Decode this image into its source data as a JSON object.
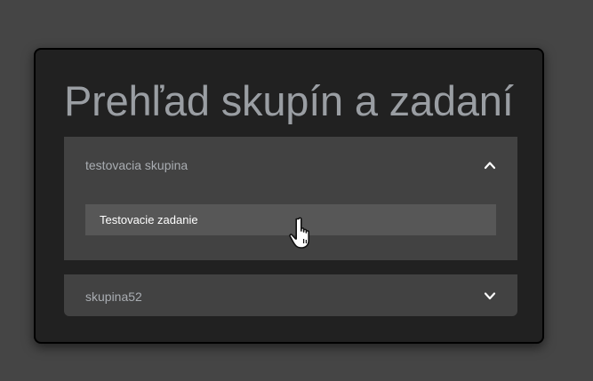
{
  "page": {
    "title": "Prehľad skupín a zadaní"
  },
  "groups": [
    {
      "name": "testovacia skupina",
      "expanded": true,
      "chevron_icon": "chevron-up-icon",
      "tasks": [
        {
          "label": "Testovacie zadanie"
        }
      ]
    },
    {
      "name": "skupina52",
      "expanded": false,
      "chevron_icon": "chevron-down-icon",
      "tasks": []
    }
  ],
  "colors": {
    "background": "#454545",
    "card": "#212121",
    "panel": "#424242",
    "task_item": "#575757",
    "title_text": "#9a9ea3"
  },
  "cursor_icon": "hand-pointer-icon"
}
